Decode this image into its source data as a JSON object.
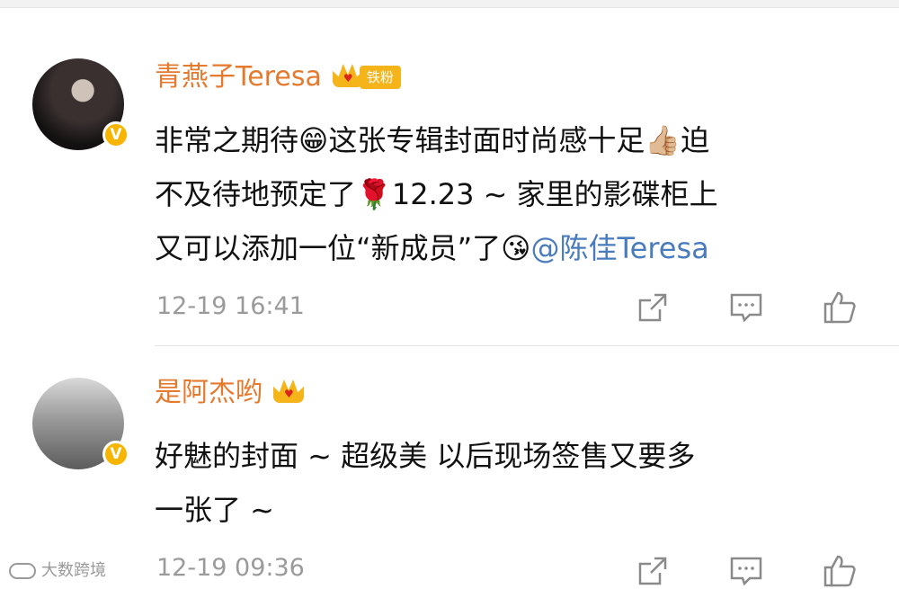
{
  "comments": [
    {
      "username": "青燕子Teresa",
      "fan_badge": "铁粉",
      "text_lines": [
        "非常之期待😁这张专辑封面时尚感十足👍🏼迫",
        "不及待地预定了🌹12.23 ~ 家里的影碟柜上",
        "又可以添加一位“新成员”了😘"
      ],
      "mention": "@陈佳Teresa",
      "time": "12-19 16:41",
      "avatar_icon": "profile-photo",
      "verified_icon": "v-badge-icon"
    },
    {
      "username": "是阿杰哟",
      "text_lines": [
        "好魅的封面 ~ 超级美 以后现场签售又要多",
        "一张了 ~"
      ],
      "time": "12-19 09:36",
      "avatar_icon": "profile-photo",
      "verified_icon": "v-badge-icon"
    }
  ],
  "actions": {
    "share_icon": "share-icon",
    "comment_icon": "comment-icon",
    "like_icon": "thumbs-up-icon"
  },
  "watermark": {
    "text": "大数跨境"
  },
  "colors": {
    "username": "#e47a2e",
    "mention": "#4a7cbd",
    "badge": "#f5b41a",
    "verified": "#f7b500",
    "time": "#9a9a9a"
  }
}
